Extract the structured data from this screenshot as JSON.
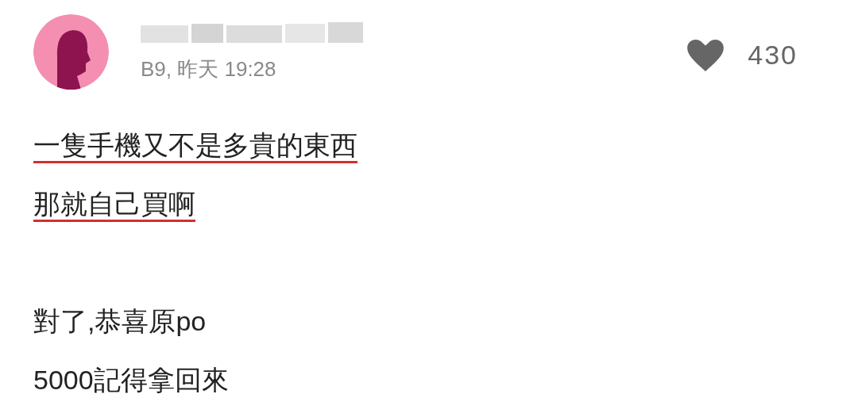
{
  "comment": {
    "meta": "B9, 昨天 19:28",
    "likes": "430",
    "paragraphs": [
      [
        {
          "text": "一隻手機又不是多貴的東西",
          "underlined": true
        },
        {
          "text": "那就自己買啊",
          "underlined": true
        }
      ],
      [
        {
          "text": "對了,恭喜原po",
          "underlined": false
        },
        {
          "text": "5000記得拿回來",
          "underlined": false
        }
      ]
    ]
  }
}
